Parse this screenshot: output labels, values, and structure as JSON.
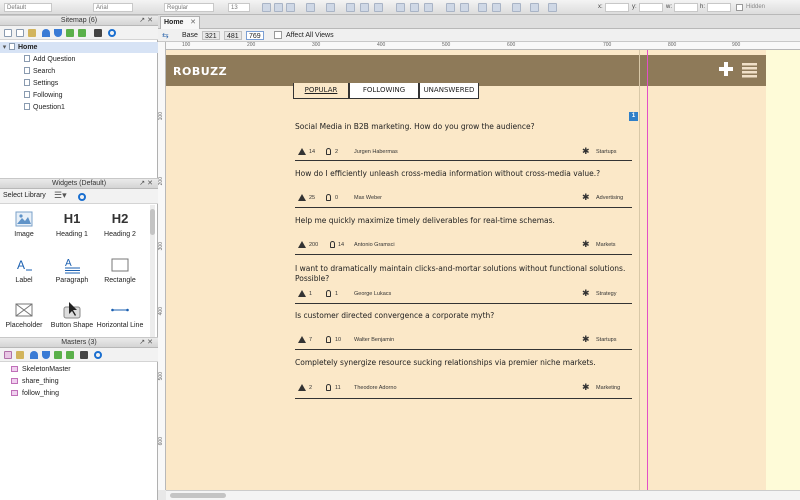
{
  "toolbar": {
    "style": "Default",
    "font": "Arial",
    "weight": "Regular",
    "size": "13",
    "x_label": "x:",
    "y_label": "y:",
    "w_label": "w:",
    "h_label": "h:",
    "hidden_label": "Hidden"
  },
  "sitemap": {
    "title": "Sitemap (6)",
    "root": "Home",
    "pages": [
      "Add Question",
      "Search",
      "Settings",
      "Following",
      "Question1"
    ]
  },
  "widgets": {
    "title": "Widgets (Default)",
    "library_label": "Select Library",
    "items": [
      {
        "label": "Image",
        "icon": "image-icon"
      },
      {
        "label": "Heading 1",
        "icon": "H1"
      },
      {
        "label": "Heading 2",
        "icon": "H2"
      },
      {
        "label": "Label",
        "icon": "label-icon"
      },
      {
        "label": "Paragraph",
        "icon": "paragraph-icon"
      },
      {
        "label": "Rectangle",
        "icon": "rectangle-icon"
      },
      {
        "label": "Placeholder",
        "icon": "placeholder-icon"
      },
      {
        "label": "Button Shape",
        "icon": "button-shape-icon"
      },
      {
        "label": "Horizontal Line",
        "icon": "horizontal-line-icon"
      }
    ]
  },
  "masters": {
    "title": "Masters (3)",
    "items": [
      "SkeletonMaster",
      "share_thing",
      "follow_thing"
    ]
  },
  "editor": {
    "tab": "Home",
    "views": {
      "base": "Base",
      "v1": "321",
      "v2": "481",
      "v3": "769"
    },
    "affect_all": "Affect All Views",
    "ruler_h": [
      "100",
      "200",
      "300",
      "400",
      "500",
      "600",
      "700",
      "800",
      "900"
    ],
    "ruler_v": [
      "100",
      "200",
      "300",
      "400",
      "500",
      "600"
    ]
  },
  "app": {
    "logo": "ROBUZZ",
    "tabs": [
      "POPULAR",
      "FOLLOWING",
      "UNANSWERED"
    ],
    "badge": "1",
    "questions": [
      {
        "title": "Social Media in B2B marketing. How do you grow the audience?",
        "votes": "14",
        "ideas": "2",
        "author": "Jurgen Habermas",
        "category": "Startups"
      },
      {
        "title": "How do I efficiently unleash cross-media information without cross-media value.?",
        "votes": "25",
        "ideas": "0",
        "author": "Max Weber",
        "category": "Advertising"
      },
      {
        "title": "Help me quickly maximize timely deliverables for real-time schemas.",
        "votes": "200",
        "ideas": "14",
        "author": "Antonio Gramsci",
        "category": "Markets"
      },
      {
        "title": "I want to dramatically maintain clicks-and-mortar solutions without functional solutions. Possible?",
        "votes": "1",
        "ideas": "1",
        "author": "George Lukacs",
        "category": "Strategy"
      },
      {
        "title": "Is customer directed convergence a corporate myth?",
        "votes": "7",
        "ideas": "10",
        "author": "Walter Benjamin",
        "category": "Startups"
      },
      {
        "title": "Completely synergize resource sucking relationships via premier niche markets.",
        "votes": "2",
        "ideas": "11",
        "author": "Theodore Adorno",
        "category": "Marketing"
      }
    ]
  }
}
